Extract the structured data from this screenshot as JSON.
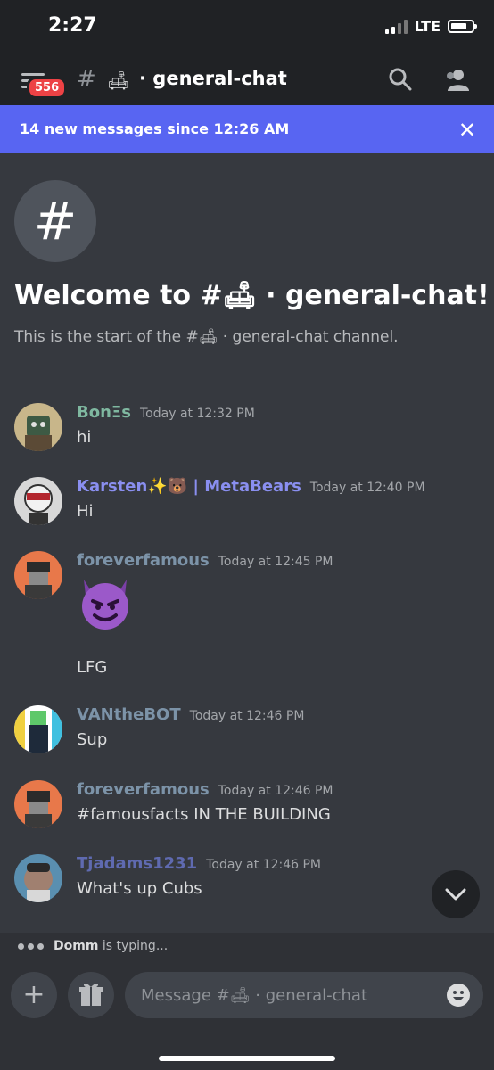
{
  "status": {
    "time": "2:27",
    "network": "LTE"
  },
  "header": {
    "badge_count": "556",
    "hash": "#",
    "channel_emoji": "🛋",
    "channel_name": "· general-chat"
  },
  "banner": {
    "text": "14 new messages since 12:26 AM",
    "close": "✕"
  },
  "channel_intro": {
    "icon": "#",
    "title": "Welcome to #🛋 · general-chat!",
    "subtitle": "This is the start of the #🛋 · general-chat channel."
  },
  "messages": [
    {
      "author": "BonΞs",
      "author_color": "#7fb8a0",
      "time": "Today at 12:32 PM",
      "text": "hi"
    },
    {
      "author": "Karsten✨🐻 | MetaBears",
      "author_color": "#8a8ff0",
      "time": "Today at 12:40 PM",
      "text": "Hi"
    },
    {
      "author": "foreverfamous",
      "author_color": "#7c93a8",
      "time": "Today at 12:45 PM",
      "emoji": "😈",
      "text": "LFG"
    },
    {
      "author": "VANtheBOT",
      "author_color": "#7c93a8",
      "time": "Today at 12:46 PM",
      "text": "Sup"
    },
    {
      "author": "foreverfamous",
      "author_color": "#7c93a8",
      "time": "Today at 12:46 PM",
      "text": "#famousfacts IN THE BUILDING"
    },
    {
      "author": "Tjadams1231",
      "author_color": "#5f6ab0",
      "time": "Today at 12:46 PM",
      "text": "What's up Cubs"
    }
  ],
  "typing": {
    "name": "Domm",
    "suffix": "is typing..."
  },
  "composer": {
    "placeholder": "Message #🛋 · general-chat",
    "plus": "+"
  },
  "colors": {
    "accent": "#5865f2",
    "badge": "#ed4245",
    "background": "#36393f"
  }
}
